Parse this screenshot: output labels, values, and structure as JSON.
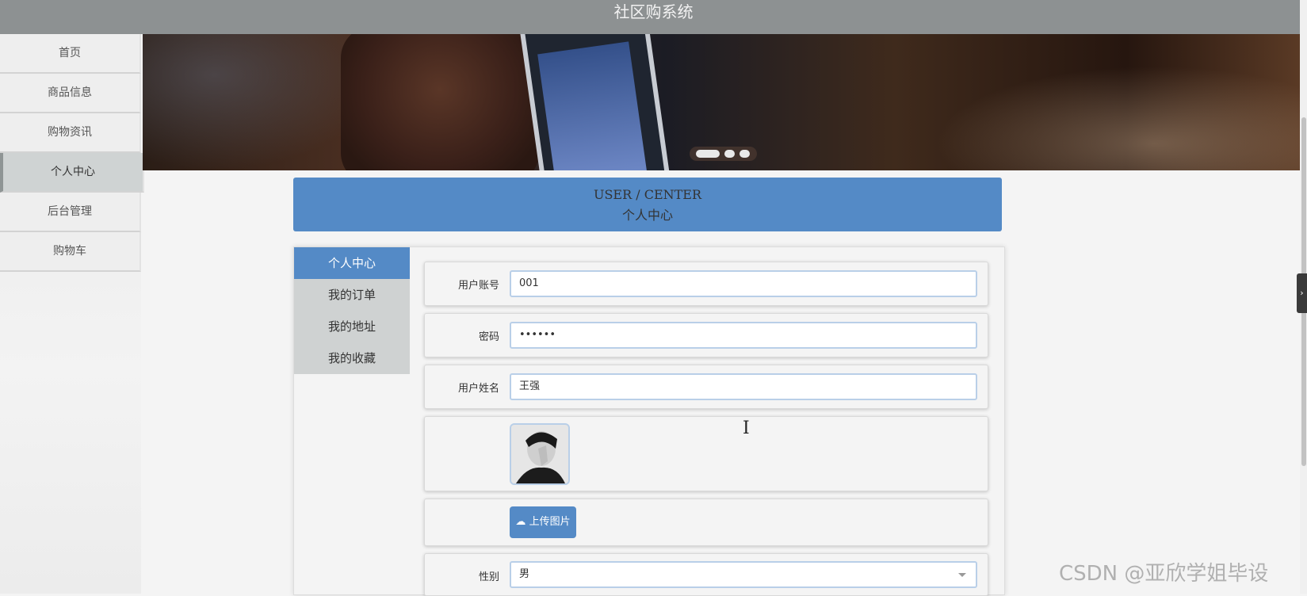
{
  "app": {
    "title": "社区购系统"
  },
  "sidebar": {
    "items": [
      {
        "label": "首页"
      },
      {
        "label": "商品信息"
      },
      {
        "label": "购物资讯"
      },
      {
        "label": "个人中心",
        "active": true
      },
      {
        "label": "后台管理"
      },
      {
        "label": "购物车"
      }
    ]
  },
  "banner": {
    "carousel_slides": 3,
    "active_slide": 1
  },
  "section_header": {
    "en": "USER / CENTER",
    "cn": "个人中心"
  },
  "tabs": [
    {
      "label": "个人中心",
      "active": true
    },
    {
      "label": "我的订单"
    },
    {
      "label": "我的地址"
    },
    {
      "label": "我的收藏"
    }
  ],
  "form": {
    "account": {
      "label": "用户账号",
      "value": "001"
    },
    "password": {
      "label": "密码",
      "value": "••••••"
    },
    "name": {
      "label": "用户姓名",
      "value": "王强"
    },
    "upload_button": "上传图片",
    "gender": {
      "label": "性别",
      "value": "男"
    }
  },
  "side_handle": {
    "label": "›"
  },
  "watermark": "CSDN @亚欣学姐毕设",
  "colors": {
    "accent": "#548ac6",
    "topbar": "#8d9192",
    "tab_inactive": "#cfd2d2"
  }
}
